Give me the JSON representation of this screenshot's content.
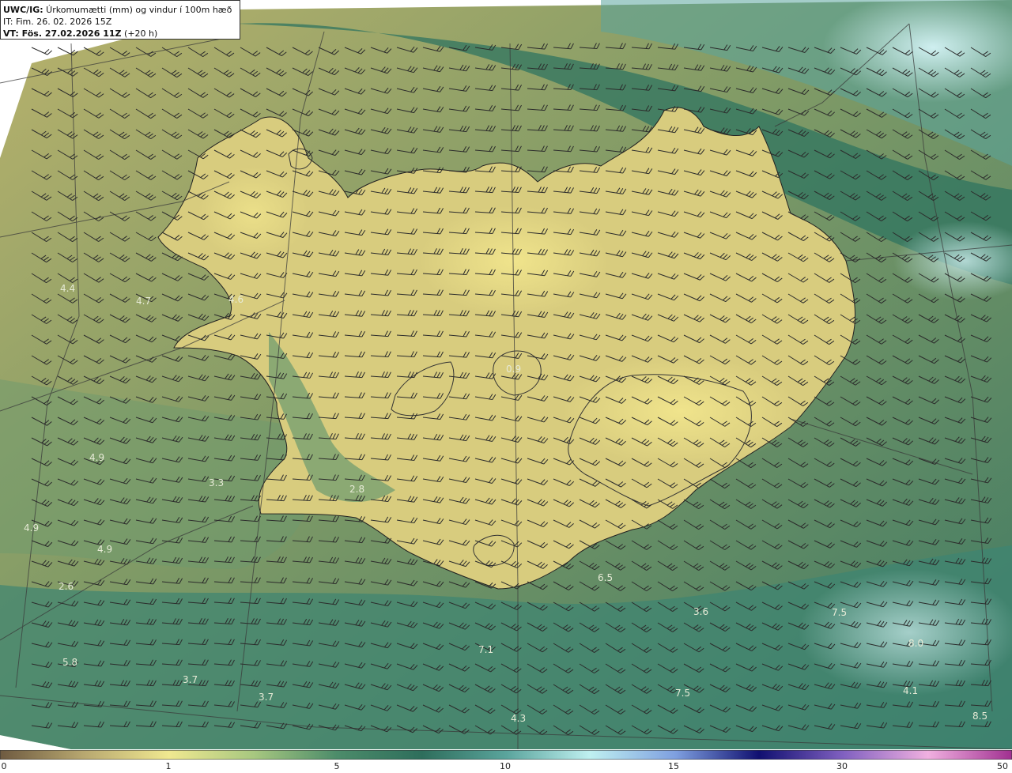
{
  "header": {
    "model_tag": "UWC/IG:",
    "title": " Úrkomumætti (mm) og vindur í 100m hæð",
    "init_time": "IT: Fim. 26. 02. 2026 15Z",
    "valid_label": "VT: Fös. 27.02.2026 11Z",
    "valid_offset": " (+20 h)"
  },
  "labels": [
    {
      "id": "v1",
      "text": "4.4"
    },
    {
      "id": "v2",
      "text": "4.7"
    },
    {
      "id": "v3",
      "text": "4.6"
    },
    {
      "id": "v4",
      "text": "4.9"
    },
    {
      "id": "v5",
      "text": "3.3"
    },
    {
      "id": "v6",
      "text": "2.8"
    },
    {
      "id": "v7",
      "text": "4.9"
    },
    {
      "id": "v8",
      "text": "4.9"
    },
    {
      "id": "v9",
      "text": "2.6"
    },
    {
      "id": "v10",
      "text": "6.5"
    },
    {
      "id": "v11",
      "text": "3.6"
    },
    {
      "id": "v12",
      "text": "7.5"
    },
    {
      "id": "v13",
      "text": "8.0"
    },
    {
      "id": "v14",
      "text": "7.1"
    },
    {
      "id": "v15",
      "text": "5.8"
    },
    {
      "id": "v16",
      "text": "3.7"
    },
    {
      "id": "v17",
      "text": "3.7"
    },
    {
      "id": "v18",
      "text": "7.5"
    },
    {
      "id": "v19",
      "text": "4.1"
    },
    {
      "id": "v20",
      "text": "4.3"
    },
    {
      "id": "v21",
      "text": "8.5"
    },
    {
      "id": "v22",
      "text": "0.9"
    }
  ],
  "colorbar": {
    "ticks": [
      "0",
      "1",
      "5",
      "10",
      "15",
      "30",
      "50"
    ],
    "colors": [
      "#6e5a40",
      "#b8a870",
      "#f0e890",
      "#a8c880",
      "#4c8c6a",
      "#2e6e5c",
      "#5aa49c",
      "#bff0f0",
      "#7fa0e0",
      "#101070",
      "#8060c0",
      "#f0b0e0",
      "#a03090"
    ]
  },
  "colors": {
    "land_tone": "#e8dc86",
    "sea_tone": "#2f7460"
  }
}
